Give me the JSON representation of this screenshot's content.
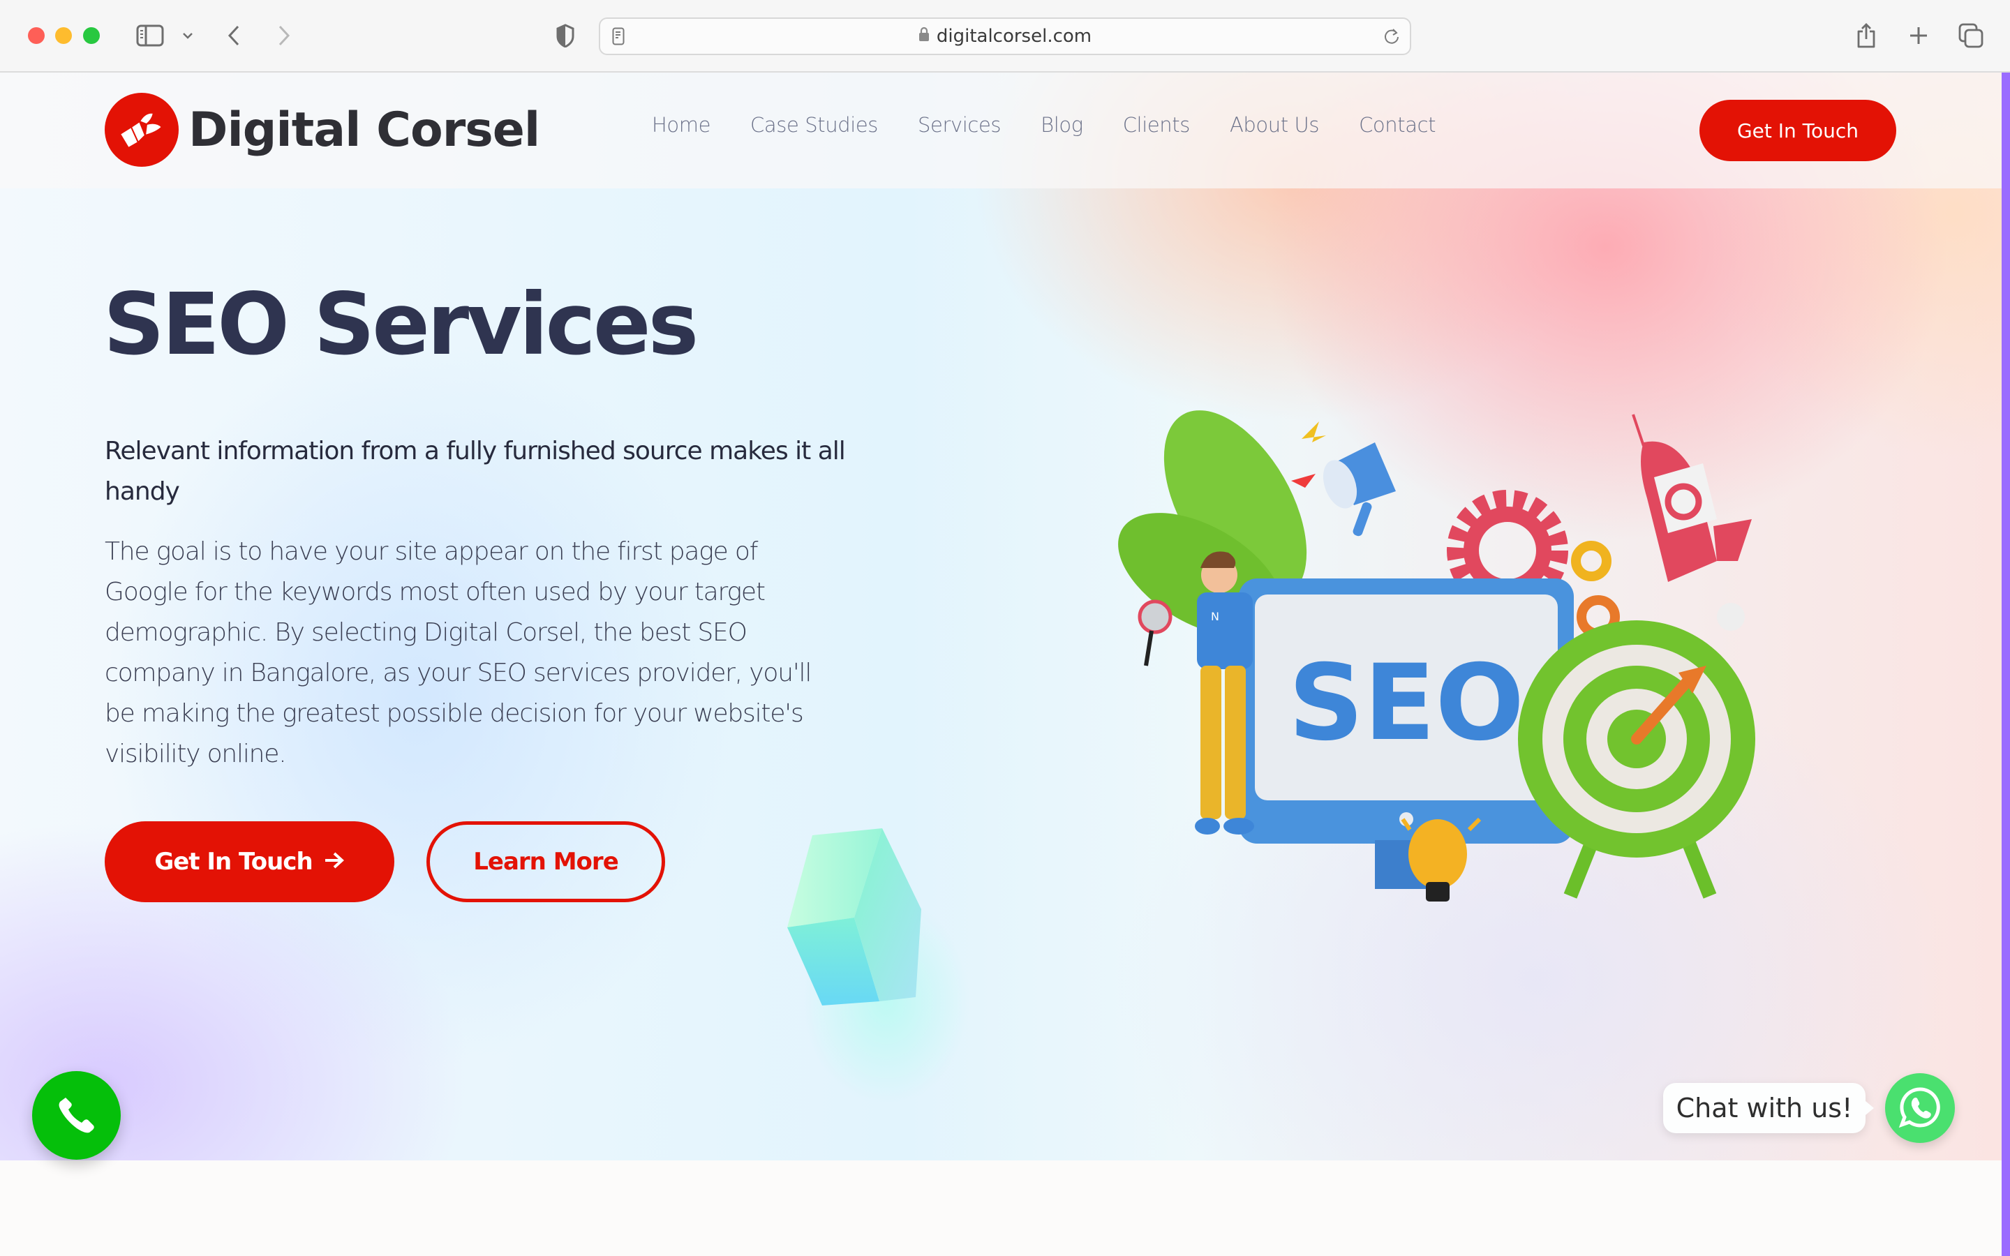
{
  "browser": {
    "url": "digitalcorsel.com",
    "icons": [
      "sidebar-icon",
      "chevron-down-icon",
      "back-icon",
      "forward-icon",
      "shield-icon",
      "reader-icon",
      "lock-icon",
      "reload-icon",
      "share-icon",
      "new-tab-icon",
      "tabs-overview-icon"
    ]
  },
  "header": {
    "brand": "Digital Corsel",
    "nav": [
      "Home",
      "Case Studies",
      "Services",
      "Blog",
      "Clients",
      "About Us",
      "Contact"
    ],
    "cta_label": "Get In Touch"
  },
  "hero": {
    "title": "SEO Services",
    "subtitle": "Relevant information from a fully furnished source makes it all handy",
    "body": "The goal is to have your site appear on the first page of Google for the keywords most often used by your target demographic. By selecting Digital Corsel, the best SEO company in Bangalore, as your SEO services provider, you'll be making the greatest possible decision for your website's visibility online.",
    "primary_button": "Get In Touch",
    "primary_button_icon": "→",
    "secondary_button": "Learn More",
    "illustration_label": "SEO"
  },
  "widgets": {
    "chat_label": "Chat with us!"
  },
  "colors": {
    "brand_red": "#e31205",
    "heading": "#2f3450",
    "nav_text": "#6b7189",
    "call_green": "#05bf0a",
    "whatsapp_green": "#4ae06f",
    "scrollbar": "#9a6cff"
  }
}
